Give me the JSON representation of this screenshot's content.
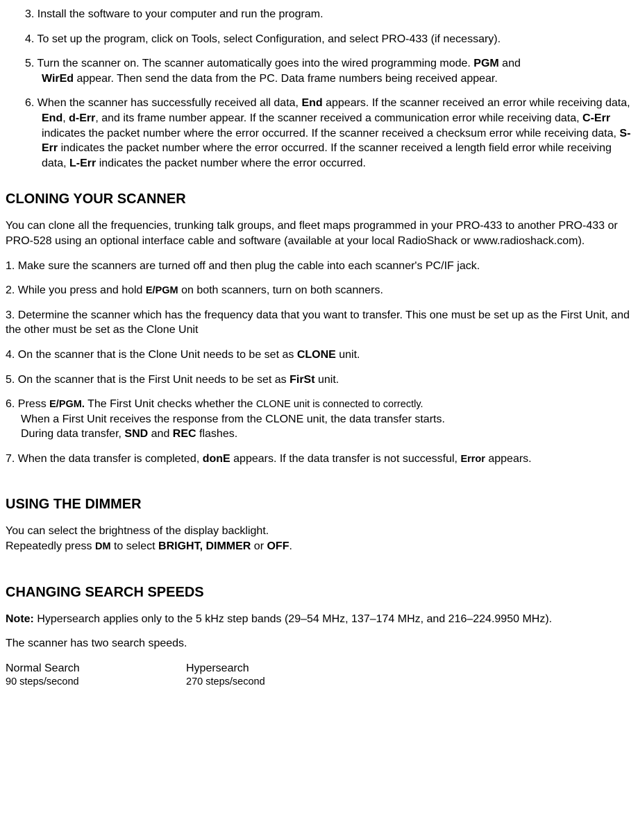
{
  "section1": {
    "step3": "3. Install the software to your computer and run the program.",
    "step4": "4. To set up the program, click on Tools, select Configuration, and select PRO-433 (if necessary).",
    "step5_pre": "5. Turn the scanner on. The scanner automatically goes into the wired programming mode. ",
    "step5_b1": "PGM",
    "step5_mid": " and ",
    "step5_b2": "WirEd",
    "step5_post": " appear. Then send the data from the PC. Data frame numbers being received appear.",
    "step6_a1": "6. When the scanner has successfully received all data, ",
    "step6_b1": "End",
    "step6_a2": " appears. If the scanner received an error while receiving data, ",
    "step6_b2": "End",
    "step6_a3": ", ",
    "step6_b3": "d-Err",
    "step6_a4": ", and its frame number appear. If the scanner received a communication error while receiving data, ",
    "step6_b4": "C-Err",
    "step6_a5": " indicates the packet number where the error occurred. If the scanner received a checksum error while receiving data, ",
    "step6_b5": "S-Err",
    "step6_a6": " indicates the packet number where the error occurred. If the scanner received a length field error while receiving data, ",
    "step6_b6": "L-Err",
    "step6_a7": " indicates the packet number where the error occurred."
  },
  "cloning": {
    "heading": "CLONING YOUR SCANNER",
    "intro": "You can clone all the frequencies, trunking talk groups, and fleet maps programmed in your PRO-433 to another PRO-433 or PRO-528 using an optional interface cable and software (available at your local RadioShack or www.radioshack.com).",
    "s1": "1. Make sure the scanners are turned off and then plug the cable into each scanner's PC/IF jack.",
    "s2_a": "2. While you press and hold ",
    "s2_b": "E/PGM",
    "s2_c": " on both scanners, turn on both scanners.",
    "s3": "3. Determine the scanner which has the frequency data that you want to transfer. This one must be set up as the First Unit, and the other must be set as the Clone Unit",
    "s4_a": "4. On the scanner that is the Clone Unit needs to be set as ",
    "s4_b": "CLONE",
    "s4_c": " unit.",
    "s5_a": "5. On the scanner that is the First Unit needs to be set as ",
    "s5_b": "FirSt",
    "s5_c": " unit.",
    "s6_a": "6. Press ",
    "s6_b": "E/PGM.",
    "s6_c": " The First Unit checks whether the ",
    "s6_d": "CLONE unit is connected to correctly.",
    "s6_line2": "When a First Unit receives the response from the CLONE unit, the data transfer starts.",
    "s6_line3_a": "During data transfer, ",
    "s6_line3_b1": "SND",
    "s6_line3_mid": " and ",
    "s6_line3_b2": "REC",
    "s6_line3_c": " flashes.",
    "s7_a": "7. When the data transfer is completed, ",
    "s7_b1": "donE",
    "s7_mid": " appears. If the data transfer is not successful, ",
    "s7_b2": "Error",
    "s7_c": " appears."
  },
  "dimmer": {
    "heading": "USING THE DIMMER",
    "line1": "You can select the brightness of the display backlight.",
    "line2_a": "Repeatedly press ",
    "line2_b": "DM",
    "line2_c": " to select ",
    "line2_d": "BRIGHT, DIMMER",
    "line2_e": " or ",
    "line2_f": "OFF",
    "line2_g": "."
  },
  "speeds": {
    "heading": "CHANGING SEARCH SPEEDS",
    "note_label": "Note:",
    "note_body": " Hypersearch applies only to the 5 kHz step bands (29–54 MHz, 137–174 MHz, and 216–224.9950 MHz).",
    "intro": "The scanner has two search speeds.",
    "col1_h": "Normal Search",
    "col1_v": "90 steps/second",
    "col2_h": "Hypersearch",
    "col2_v": "270 steps/second"
  }
}
